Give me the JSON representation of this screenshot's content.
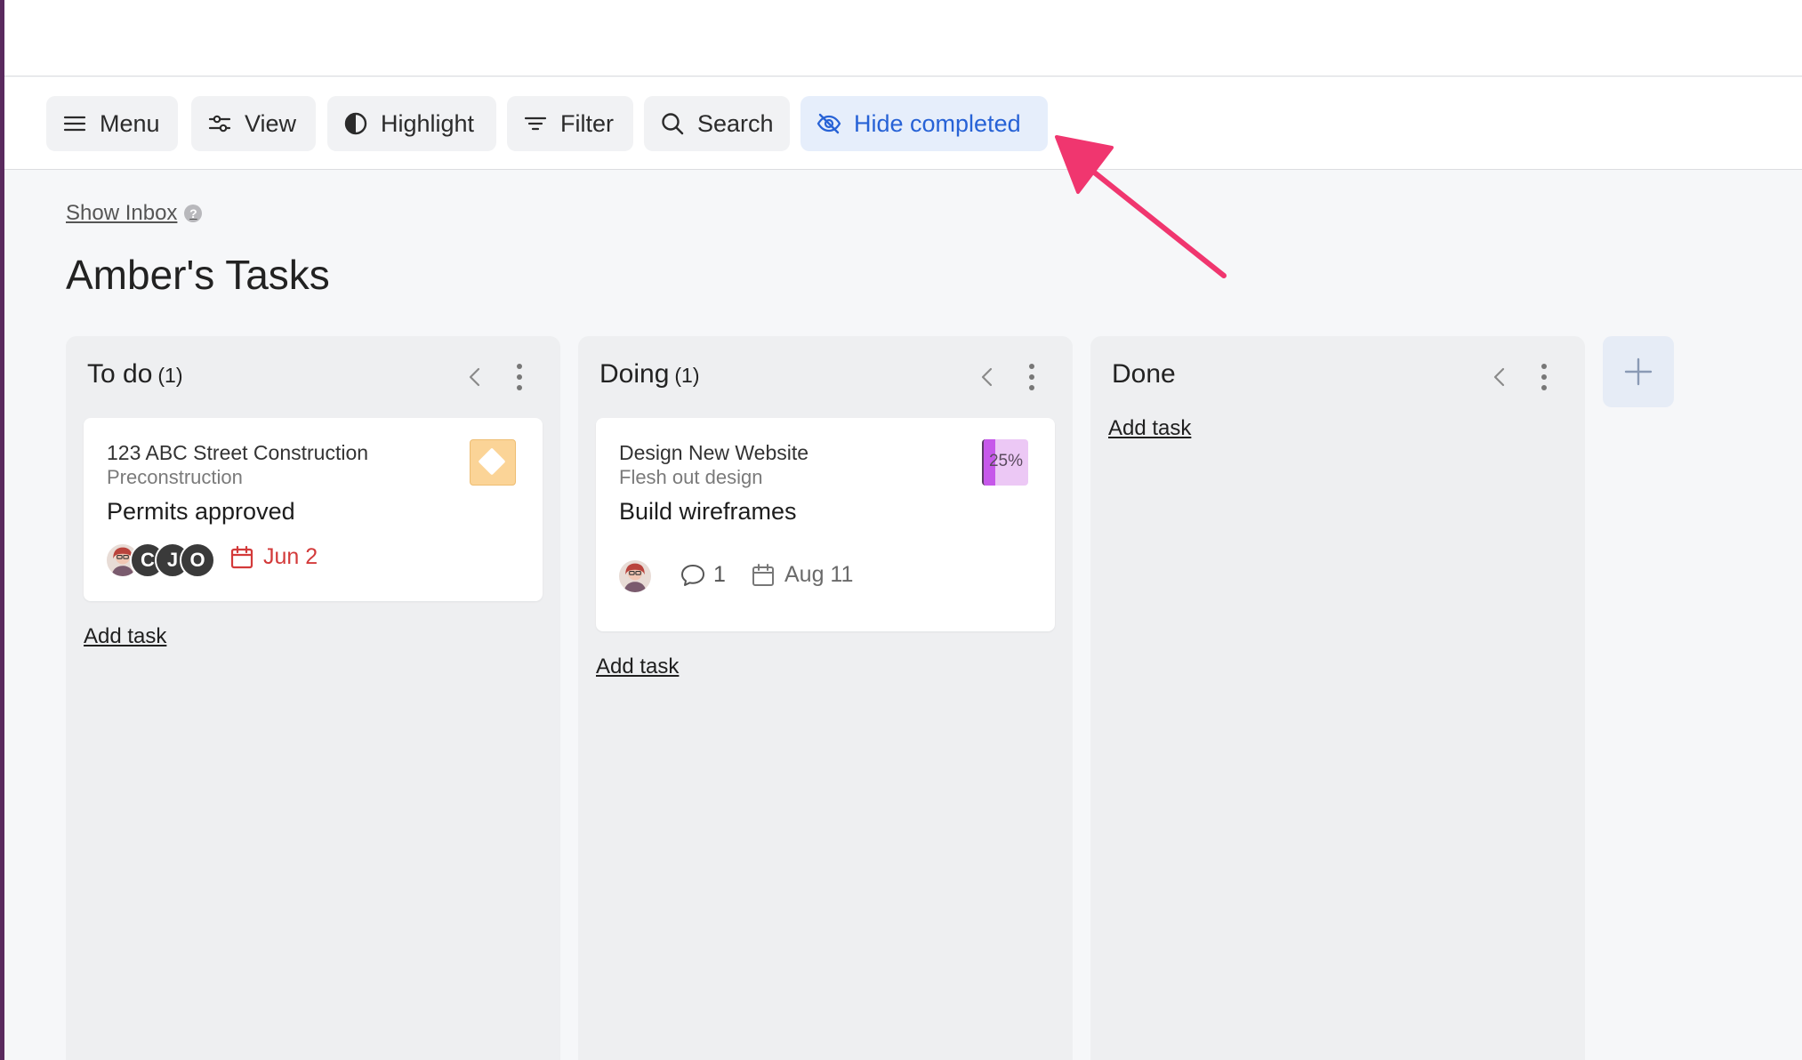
{
  "toolbar": {
    "menu": "Menu",
    "view": "View",
    "highlight": "Highlight",
    "filter": "Filter",
    "search": "Search",
    "hide_completed": "Hide completed"
  },
  "show_inbox": "Show Inbox",
  "page_title": "Amber's Tasks",
  "columns": [
    {
      "title": "To do",
      "count": "(1)",
      "add_task": "Add task",
      "card": {
        "project": "123 ABC Street Construction",
        "section": "Preconstruction",
        "title": "Permits approved",
        "assignees": [
          "C",
          "J",
          "O"
        ],
        "due": "Jun 2"
      }
    },
    {
      "title": "Doing",
      "count": "(1)",
      "add_task": "Add task",
      "card": {
        "project": "Design New Website",
        "section": "Flesh out design",
        "title": "Build wireframes",
        "progress_percent": 25,
        "progress_label": "25%",
        "comments": "1",
        "due": "Aug 11"
      }
    },
    {
      "title": "Done",
      "count": "",
      "add_task": "Add task"
    }
  ],
  "colors": {
    "accent": "#2762d6",
    "overdue": "#d33a3a",
    "milestone": "#fbd497",
    "progress": "#c658ea",
    "annotation_arrow": "#f0366f"
  }
}
